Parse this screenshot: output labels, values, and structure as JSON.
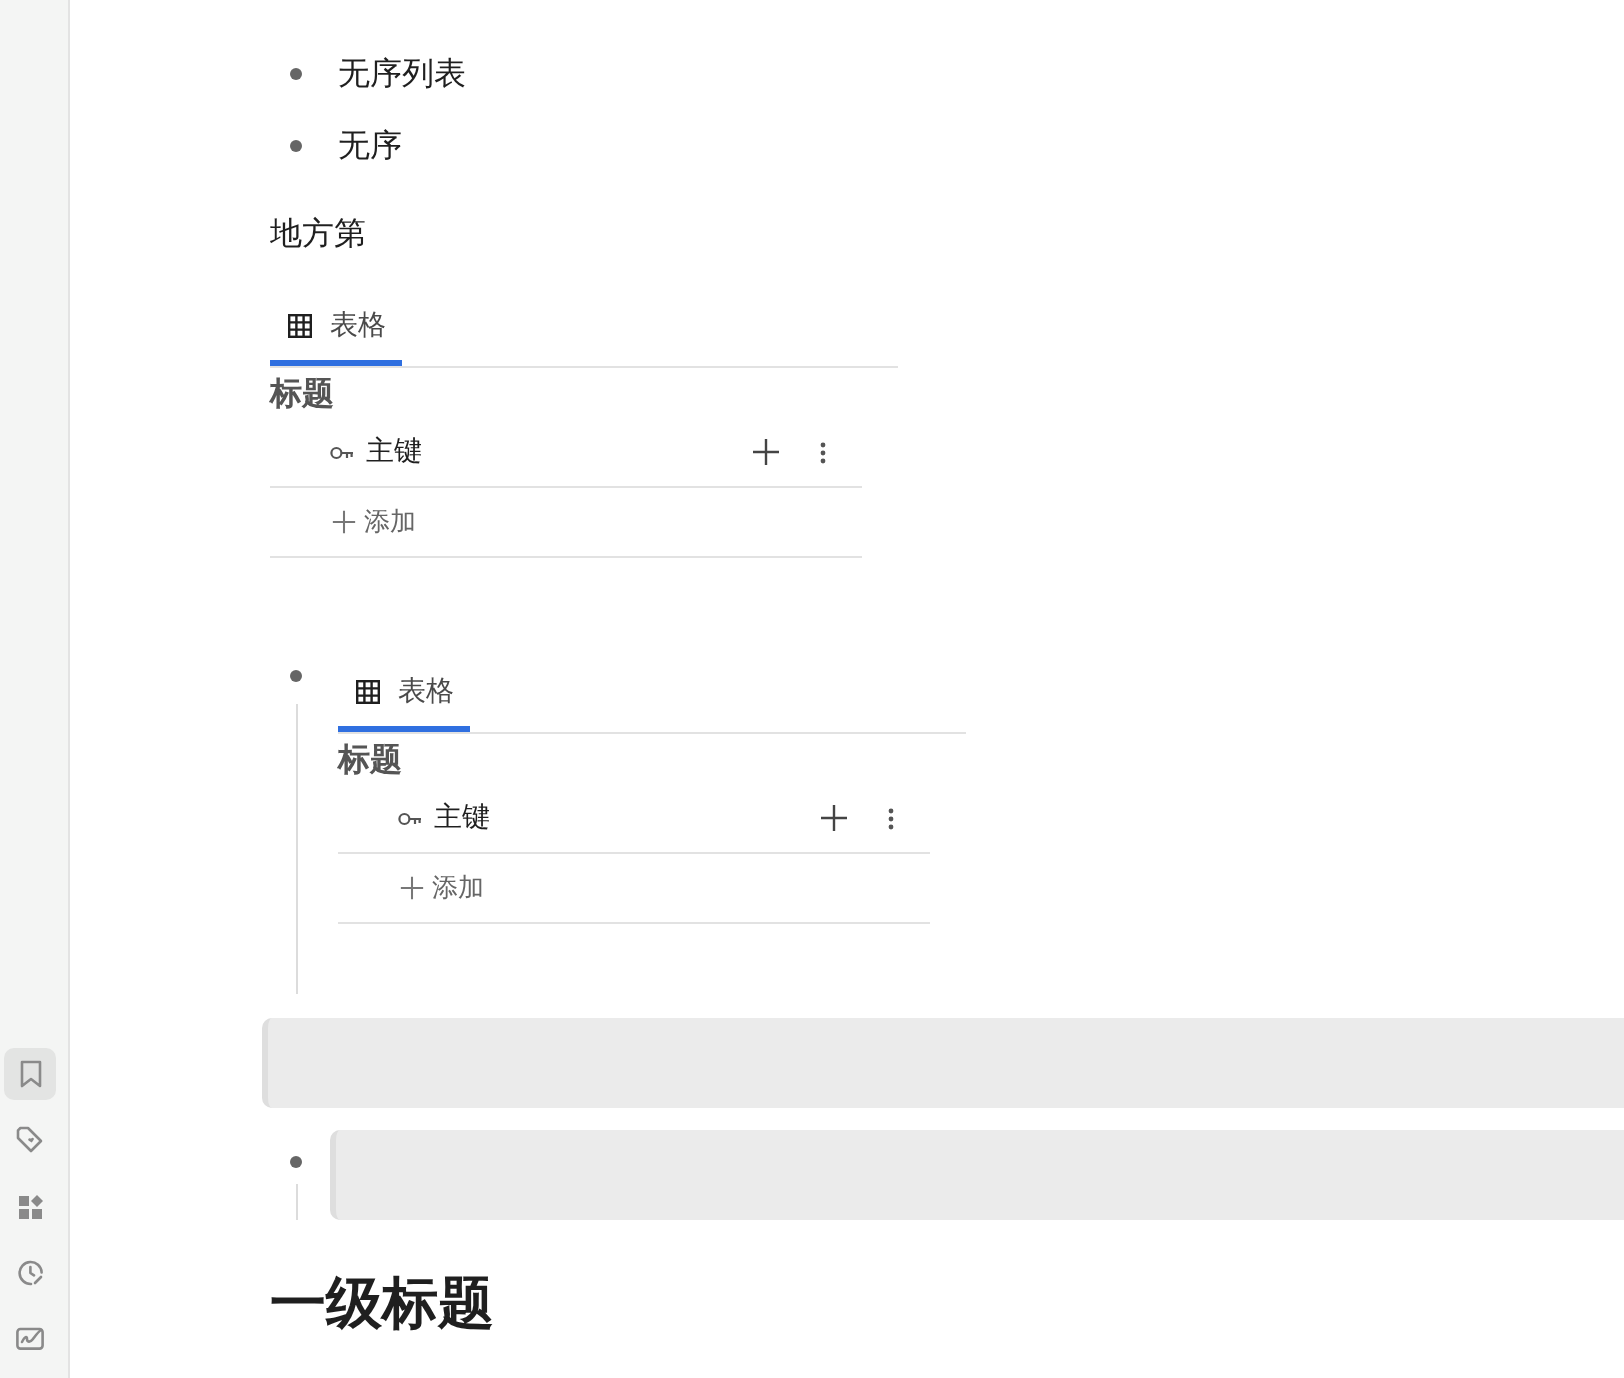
{
  "sidebar": {
    "items": [
      {
        "kind": "bookmark",
        "selected": true
      },
      {
        "kind": "tag",
        "selected": false
      },
      {
        "kind": "shapes",
        "selected": false
      },
      {
        "kind": "clock",
        "selected": false
      },
      {
        "kind": "signature",
        "selected": false
      }
    ]
  },
  "blocks": [
    {
      "kind": "bullet",
      "text": "无序列表"
    },
    {
      "kind": "bullet",
      "text": "无序"
    },
    {
      "kind": "paragraph",
      "text": "地方第"
    },
    {
      "kind": "table",
      "tabs": [
        {
          "label": "表格",
          "selected": true
        }
      ],
      "title": "标题",
      "fields": [
        {
          "kind": "primary_key",
          "name": "主键"
        }
      ],
      "add_label": "添加"
    },
    {
      "kind": "bullet",
      "children": [
        {
          "kind": "table",
          "tabs": [
            {
              "label": "表格",
              "selected": true
            }
          ],
          "title": "标题",
          "fields": [
            {
              "kind": "primary_key",
              "name": "主键"
            }
          ],
          "add_label": "添加"
        }
      ]
    },
    {
      "kind": "blank_block"
    },
    {
      "kind": "bullet",
      "children": [
        {
          "kind": "blank_block"
        }
      ]
    },
    {
      "kind": "heading",
      "text": "一级标题"
    }
  ]
}
